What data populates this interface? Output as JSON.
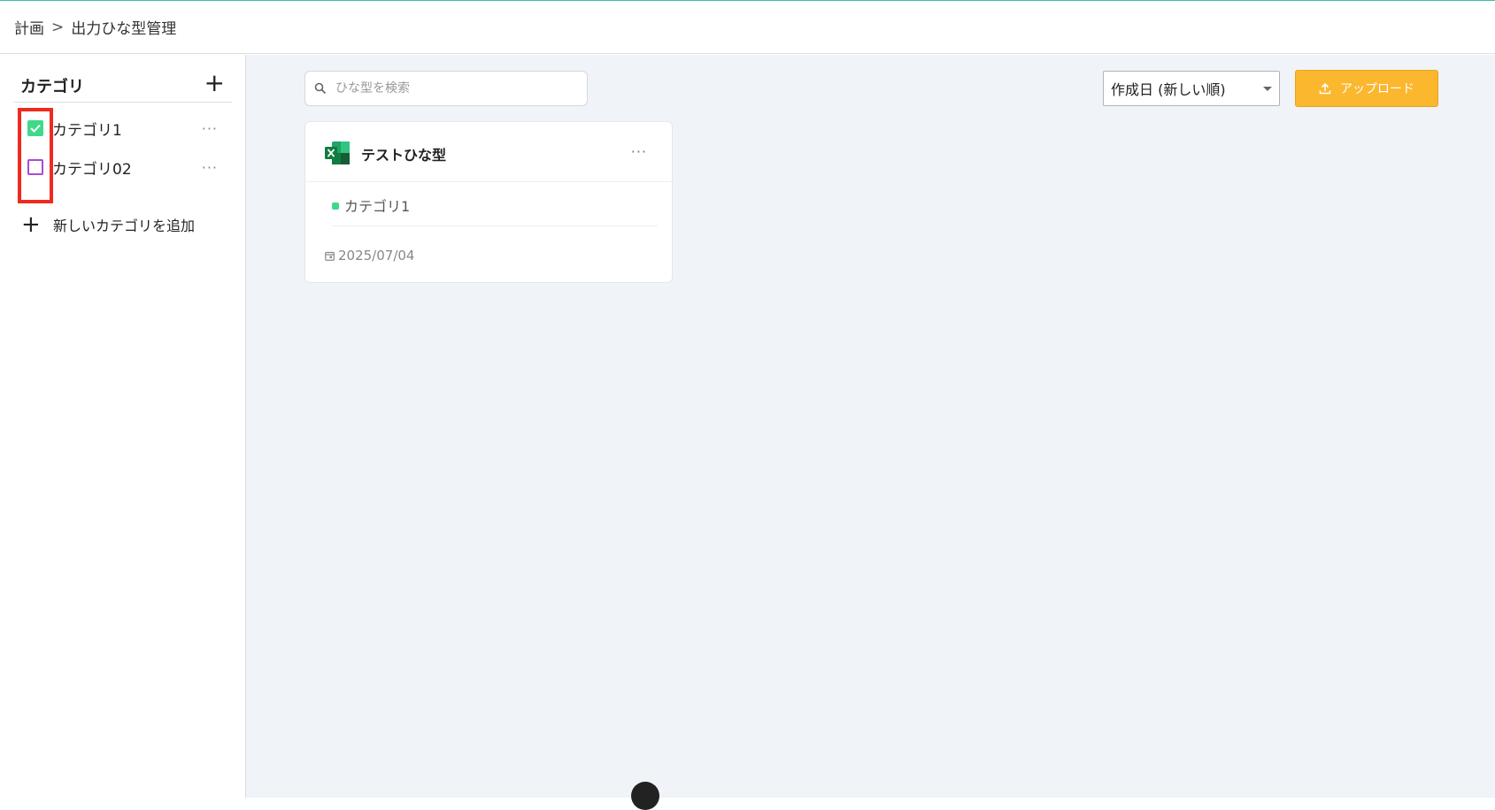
{
  "breadcrumb": {
    "parent": "計画",
    "separator": ">",
    "current": "出力ひな型管理"
  },
  "sidebar": {
    "title": "カテゴリ",
    "add_icon": "plus-icon",
    "categories": [
      {
        "label": "カテゴリ1",
        "checked": true,
        "color": "#3fd98a",
        "more": "···"
      },
      {
        "label": "カテゴリ02",
        "checked": false,
        "color": "#a94ad9",
        "more": "···"
      }
    ],
    "add_new_label": "新しいカテゴリを追加"
  },
  "toolbar": {
    "search_placeholder": "ひな型を検索",
    "sort_value": "作成日 (新しい順)",
    "upload_label": "アップロード",
    "upload_color": "#fbb72d"
  },
  "templates": [
    {
      "title": "テストひな型",
      "file_icon": "excel-icon",
      "category": "カテゴリ1",
      "category_color": "#3fd98a",
      "date": "2025/07/04",
      "more": "···"
    }
  ],
  "colors": {
    "accent_top": "#3bbfb4",
    "highlight": "#ee2b1f",
    "main_bg": "#f0f3f8"
  }
}
